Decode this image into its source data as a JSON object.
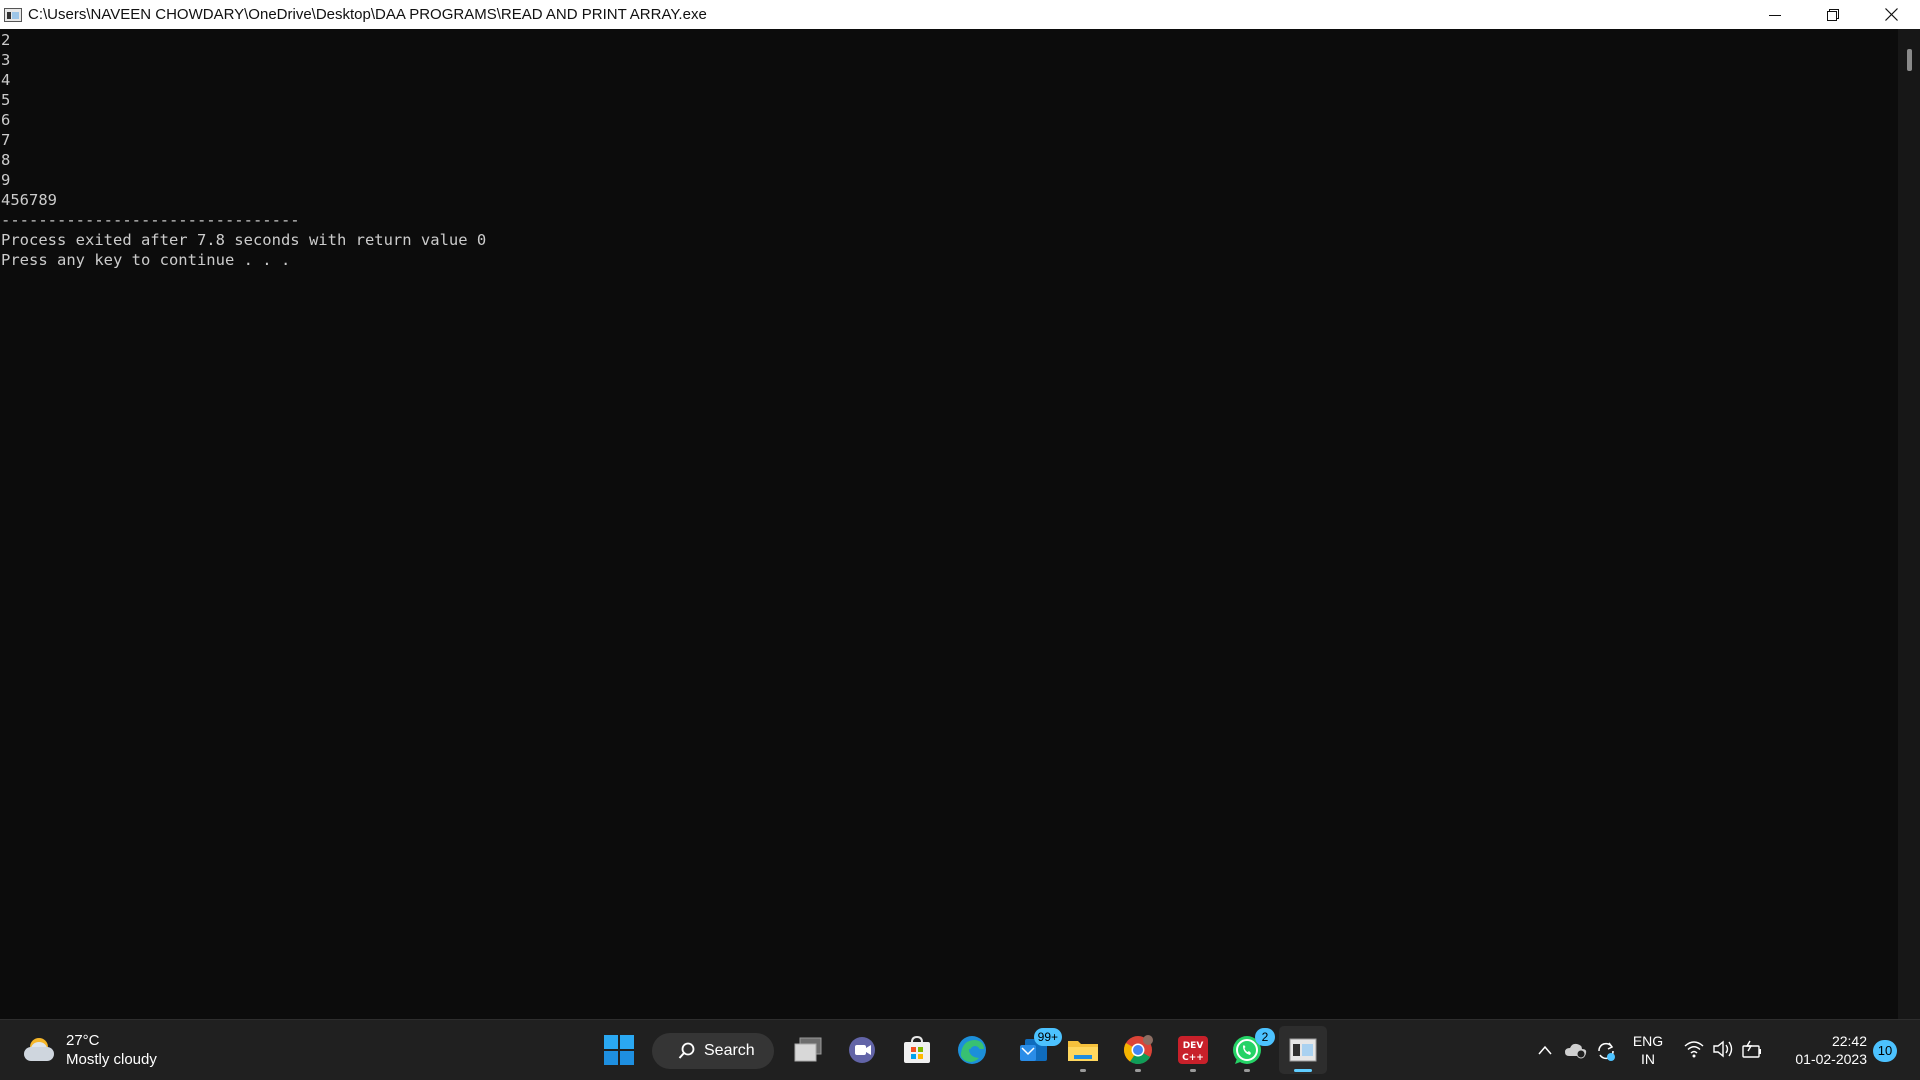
{
  "window": {
    "title": "C:\\Users\\NAVEEN CHOWDARY\\OneDrive\\Desktop\\DAA PROGRAMS\\READ AND PRINT ARRAY.exe",
    "controls": [
      "minimize-icon",
      "restore-icon",
      "close-icon"
    ]
  },
  "console": {
    "lines": [
      "2",
      "3",
      "4",
      "5",
      "6",
      "7",
      "8",
      "9",
      "456789",
      "--------------------------------",
      "Process exited after 7.8 seconds with return value 0",
      "Press any key to continue . . ."
    ]
  },
  "taskbar": {
    "weather": {
      "temp": "27°C",
      "condition": "Mostly cloudy",
      "icon": "partly-cloudy-icon"
    },
    "search_label": "Search",
    "apps": [
      {
        "name": "start",
        "icon": "windows-start-icon"
      },
      {
        "name": "task-view",
        "icon": "task-view-icon"
      },
      {
        "name": "chat",
        "icon": "teams-chat-icon"
      },
      {
        "name": "store",
        "icon": "microsoft-store-icon"
      },
      {
        "name": "edge",
        "icon": "edge-icon"
      },
      {
        "name": "mail",
        "icon": "mail-icon",
        "badge": "99+"
      },
      {
        "name": "file-explorer",
        "icon": "folder-icon"
      },
      {
        "name": "chrome",
        "icon": "chrome-icon"
      },
      {
        "name": "dev-cpp",
        "icon": "dev-cpp-icon",
        "label": "DEV C++"
      },
      {
        "name": "whatsapp",
        "icon": "whatsapp-icon",
        "badge": "2"
      },
      {
        "name": "console",
        "icon": "console-window-icon"
      }
    ],
    "tray": {
      "language_top": "ENG",
      "language_bottom": "IN",
      "time": "22:42",
      "date": "01-02-2023",
      "notifications": "10"
    },
    "colors": {
      "accent": "#60cdff",
      "badge": "#4cc2ff",
      "background": "#202020"
    }
  }
}
